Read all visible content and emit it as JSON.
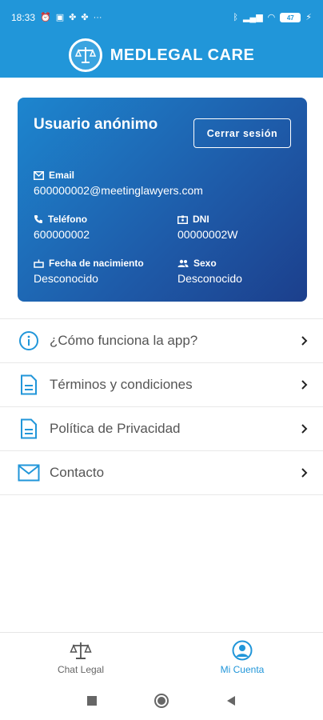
{
  "status_bar": {
    "time": "18:33",
    "battery": "47"
  },
  "header": {
    "brand": "MEDLEGAL CARE",
    "accent": "#2196d9"
  },
  "profile": {
    "name": "Usuario anónimo",
    "logout_label": "Cerrar sesión",
    "email_label": "Email",
    "email_value": "600000002@meetinglawyers.com",
    "phone_label": "Teléfono",
    "phone_value": "600000002",
    "dni_label": "DNI",
    "dni_value": "00000002W",
    "birth_label": "Fecha de nacimiento",
    "birth_value": "Desconocido",
    "sex_label": "Sexo",
    "sex_value": "Desconocido"
  },
  "menu": {
    "items": [
      {
        "label": "¿Cómo funciona la app?",
        "icon": "info-icon"
      },
      {
        "label": "Términos y condiciones",
        "icon": "document-icon"
      },
      {
        "label": "Política de Privacidad",
        "icon": "document-icon"
      },
      {
        "label": "Contacto",
        "icon": "mail-icon"
      }
    ]
  },
  "bottom_nav": {
    "chat_label": "Chat Legal",
    "account_label": "Mi Cuenta",
    "active": "Mi Cuenta"
  }
}
